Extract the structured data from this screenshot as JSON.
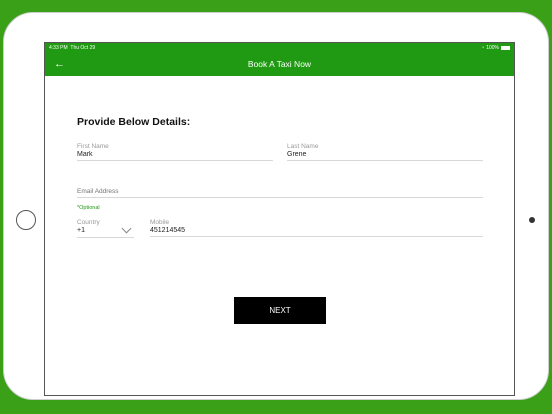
{
  "status_bar": {
    "time": "4:33 PM",
    "date": "Thu Oct 29",
    "battery": "100%"
  },
  "app_bar": {
    "title": "Book A Taxi Now",
    "back_icon": "←"
  },
  "form": {
    "heading": "Provide Below Details:",
    "first_name": {
      "label": "First Name",
      "value": "Mark"
    },
    "last_name": {
      "label": "Last Name",
      "value": "Grene"
    },
    "email": {
      "placeholder": "Email Address",
      "value": "",
      "hint": "*Optional"
    },
    "country": {
      "label": "Country",
      "value": "+1"
    },
    "mobile": {
      "label": "Mobile",
      "value": "451214545"
    },
    "next_label": "NEXT"
  },
  "colors": {
    "brand": "#1f9a12",
    "background": "#3aa017",
    "button": "#000000"
  }
}
